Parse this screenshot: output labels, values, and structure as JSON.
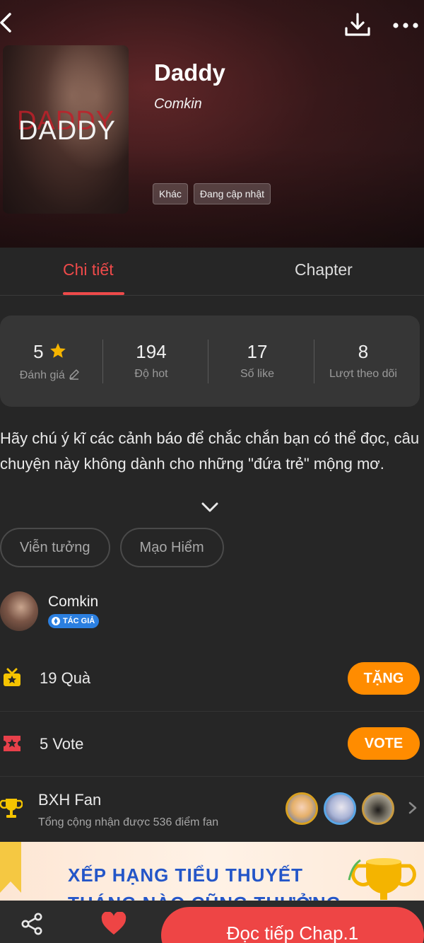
{
  "header": {
    "title": "Daddy",
    "author": "Comkin",
    "cover_text": "DADDY",
    "tags": [
      "Khác",
      "Đang cập nhật"
    ]
  },
  "tabs": [
    {
      "label": "Chi tiết",
      "active": true
    },
    {
      "label": "Chapter",
      "active": false
    }
  ],
  "stats": [
    {
      "value": "5",
      "label": "Đánh giá"
    },
    {
      "value": "194",
      "label": "Độ hot"
    },
    {
      "value": "17",
      "label": "Số like"
    },
    {
      "value": "8",
      "label": "Lượt theo dõi"
    }
  ],
  "description": "Hãy chú ý kĩ các cảnh báo để chắc chắn bạn có thể đọc, câu chuyện này không dành cho những \"đứa trẻ\" mộng mơ.",
  "genres": [
    "Viễn tưởng",
    "Mạo Hiểm"
  ],
  "author_section": {
    "name": "Comkin",
    "badge": "TÁC GIẢ"
  },
  "gifts": {
    "text": "19 Quà",
    "button": "TẶNG"
  },
  "votes": {
    "text": "5 Vote",
    "button": "VOTE"
  },
  "fan_ranking": {
    "title": "BXH Fan",
    "subtitle": "Tổng cộng nhận được 536 điểm fan"
  },
  "banner": {
    "line1": "XẾP HẠNG TIỂU THUYẾT",
    "line2": "THÁNG NÀO CŨNG THƯỞNG"
  },
  "bottom_bar": {
    "read_button": "Đọc tiếp Chap.1"
  },
  "colors": {
    "accent": "#ee4a4a",
    "orange": "#ff8c00",
    "background": "#262626",
    "card": "#363636"
  }
}
